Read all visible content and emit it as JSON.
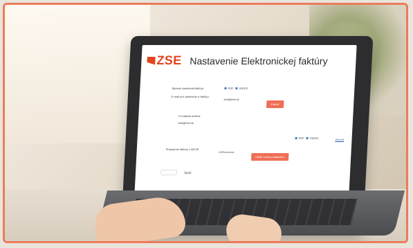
{
  "screen": {
    "logo_text": "ZSE",
    "title": "Nastavenie Elektronickej faktúry",
    "rows": [
      {
        "label": "Spôsob zasielania faktúry:"
      },
      {
        "label": "E-mail pre zasielanie e-faktúry:"
      },
      {
        "label": "E-mailová adresa"
      },
      {
        "label": "Prepojenie faktúry s MOJE"
      }
    ],
    "options": [
      {
        "label": "PDF"
      },
      {
        "label": "ISDOC"
      }
    ],
    "options2": [
      {
        "label": "PDF"
      },
      {
        "label": "ISDOC"
      }
    ],
    "email_value": "test@test.sk",
    "email_value2": "test@test.sk",
    "phone_value": "+421xxxxxxx",
    "button_change": "Zmeniť",
    "button_save": "Uložiť zmeny nastavení",
    "link_change": "Zmeniť",
    "back": "Späť"
  },
  "colors": {
    "brand": "#e2451f",
    "button": "#ef6f55",
    "frame": "#ec7b5c"
  }
}
